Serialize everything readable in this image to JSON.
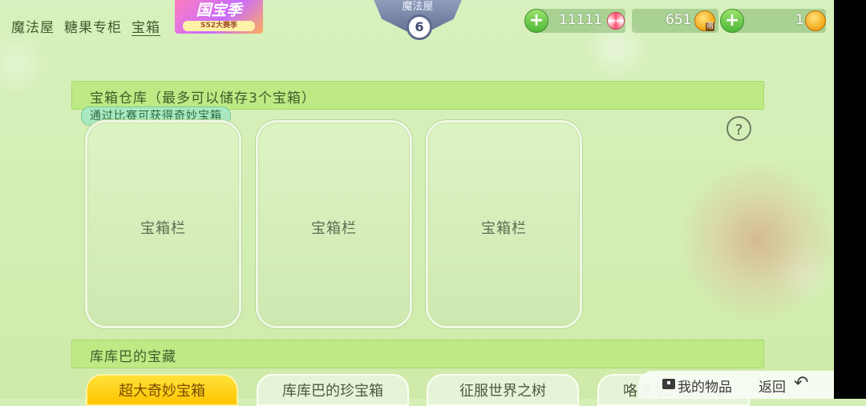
{
  "tabs": [
    "魔法屋",
    "糖果专柜",
    "宝箱"
  ],
  "promo": {
    "title": "国宝季",
    "subtitle": "S52大赛季"
  },
  "badge": {
    "title": "魔法屋",
    "level": "6"
  },
  "currency": {
    "candy": "11111",
    "coins": "651",
    "coins_gift_badge": "赠",
    "gems": "1",
    "plus": "+"
  },
  "warehouse": {
    "title": "宝箱仓库（最多可以储存3个宝箱）",
    "tooltip": "通过比赛可获得奇妙宝箱",
    "help": "?",
    "slots": [
      "宝箱栏",
      "宝箱栏",
      "宝箱栏"
    ]
  },
  "treasure": {
    "title": "库库巴的宝藏",
    "tabs": [
      "超大奇妙宝箱",
      "库库巴的珍宝箱",
      "征服世界之树",
      "咯泽龙的征服箱"
    ]
  },
  "actions": {
    "my_items": "我的物品",
    "back": "返回"
  },
  "colors": {
    "background": "#d6efb6",
    "section_bar": "#bdea84",
    "active_tab": "#ffd21f"
  }
}
